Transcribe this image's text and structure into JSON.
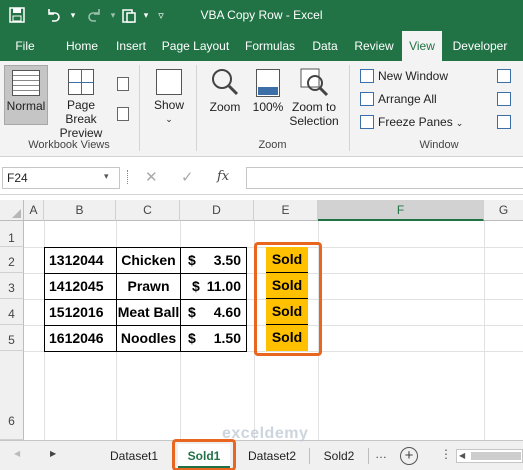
{
  "window": {
    "title": "VBA Copy Row  -  Excel"
  },
  "ribbon_tabs": [
    "File",
    "Home",
    "Insert",
    "Page Layout",
    "Formulas",
    "Data",
    "Review",
    "View",
    "Developer"
  ],
  "active_tab": "View",
  "workbook_views": {
    "normal": "Normal",
    "page_break_line1": "Page Break",
    "page_break_line2": "Preview",
    "group_label": "Workbook Views"
  },
  "show": {
    "label": "Show"
  },
  "zoom": {
    "zoom_label": "Zoom",
    "hundred_label": "100%",
    "zoom_to_line1": "Zoom to",
    "zoom_to_line2": "Selection",
    "group_label": "Zoom"
  },
  "window_group": {
    "new_window": "New Window",
    "arrange_all": "Arrange All",
    "freeze_panes": "Freeze Panes",
    "group_label": "Window"
  },
  "formula_bar": {
    "name_box": "F24",
    "fx": "fx",
    "content": ""
  },
  "columns": [
    "A",
    "B",
    "C",
    "D",
    "E",
    "F",
    "G"
  ],
  "rows": [
    "1",
    "2",
    "3",
    "4",
    "5",
    "6"
  ],
  "table": [
    {
      "id": "1312044",
      "item": "Chicken",
      "currency": "$",
      "price": "3.50",
      "status": "Sold"
    },
    {
      "id": "1412045",
      "item": "Prawn",
      "currency": "$",
      "price": "11.00",
      "status": "Sold"
    },
    {
      "id": "1512016",
      "item": "Meat Ball",
      "currency": "$",
      "price": "4.60",
      "status": "Sold"
    },
    {
      "id": "1612046",
      "item": "Noodles",
      "currency": "$",
      "price": "1.50",
      "status": "Sold"
    }
  ],
  "sheet_tabs": [
    "Dataset1",
    "Sold1",
    "Dataset2",
    "Sold2"
  ],
  "active_sheet": "Sold1",
  "watermark": "exceldemy",
  "colors": {
    "excel_green": "#217346",
    "sold_fill": "#ffc000",
    "highlight": "#e8661f"
  }
}
